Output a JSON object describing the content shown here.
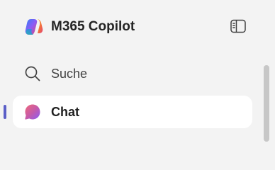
{
  "header": {
    "app_title": "M365 Copilot",
    "logo_icon": "copilot-logo-icon",
    "panel_toggle_icon": "sidebar-panel-icon"
  },
  "nav": {
    "items": [
      {
        "label": "Suche",
        "icon": "search-icon",
        "active": false
      },
      {
        "label": "Chat",
        "icon": "chat-icon",
        "active": true
      }
    ]
  },
  "colors": {
    "background": "#f3f3f3",
    "active_item_background": "#ffffff",
    "active_indicator": "#5b5fc7",
    "scrollbar_thumb": "#c7c7c7"
  }
}
